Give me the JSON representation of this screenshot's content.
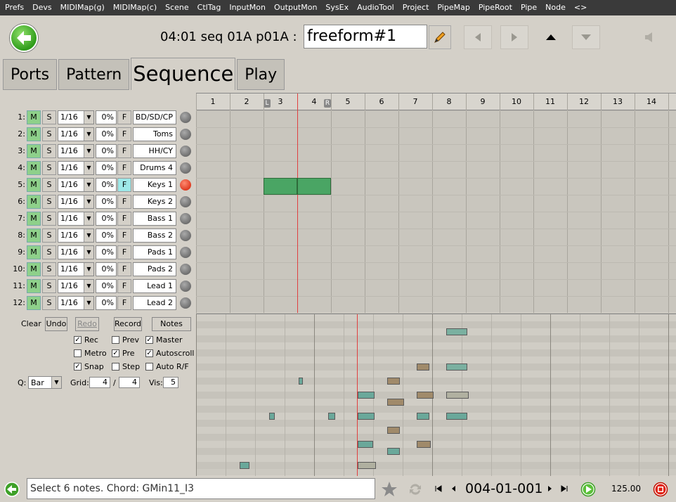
{
  "menu": [
    "Prefs",
    "Devs",
    "MIDIMap(g)",
    "MIDIMap(c)",
    "Scene",
    "CtlTag",
    "InputMon",
    "OutputMon",
    "SysEx",
    "AudioTool",
    "Project",
    "PipeMap",
    "PipeRoot",
    "Pipe",
    "Node",
    "<>"
  ],
  "header": {
    "seq_label": "04:01 seq  01A  p01A :",
    "seq_name": "freeform#1"
  },
  "tabs": [
    "Ports",
    "Pattern",
    "Sequence",
    "Play"
  ],
  "active_tab": "Sequence",
  "tracks": [
    {
      "num": "1:",
      "quant": "1/16",
      "pct": "0%",
      "name": "BD/SD/CP",
      "f_on": false,
      "active": false
    },
    {
      "num": "2:",
      "quant": "1/16",
      "pct": "0%",
      "name": "Toms",
      "f_on": false,
      "active": false
    },
    {
      "num": "3:",
      "quant": "1/16",
      "pct": "0%",
      "name": "HH/CY",
      "f_on": false,
      "active": false
    },
    {
      "num": "4:",
      "quant": "1/16",
      "pct": "0%",
      "name": "Drums 4",
      "f_on": false,
      "active": false
    },
    {
      "num": "5:",
      "quant": "1/16",
      "pct": "0%",
      "name": "Keys 1",
      "f_on": true,
      "active": true
    },
    {
      "num": "6:",
      "quant": "1/16",
      "pct": "0%",
      "name": "Keys 2",
      "f_on": false,
      "active": false
    },
    {
      "num": "7:",
      "quant": "1/16",
      "pct": "0%",
      "name": "Bass 1",
      "f_on": false,
      "active": false
    },
    {
      "num": "8:",
      "quant": "1/16",
      "pct": "0%",
      "name": "Bass 2",
      "f_on": false,
      "active": false
    },
    {
      "num": "9:",
      "quant": "1/16",
      "pct": "0%",
      "name": "Pads 1",
      "f_on": false,
      "active": false
    },
    {
      "num": "10:",
      "quant": "1/16",
      "pct": "0%",
      "name": "Pads 2",
      "f_on": false,
      "active": false
    },
    {
      "num": "11:",
      "quant": "1/16",
      "pct": "0%",
      "name": "Lead 1",
      "f_on": false,
      "active": false
    },
    {
      "num": "12:",
      "quant": "1/16",
      "pct": "0%",
      "name": "Lead 2",
      "f_on": false,
      "active": false
    }
  ],
  "track_button_labels": {
    "mute": "M",
    "solo": "S",
    "follow": "F"
  },
  "ruler": [
    "1",
    "2",
    "3",
    "4",
    "5",
    "6",
    "7",
    "8",
    "9",
    "10",
    "11",
    "12",
    "13",
    "14"
  ],
  "loop_markers": {
    "left": "L",
    "right": "R"
  },
  "controls": {
    "clear": "Clear",
    "undo": "Undo",
    "redo": "Redo",
    "record": "Record",
    "notes": "Notes",
    "checkboxes": [
      {
        "label": "Rec",
        "checked": true
      },
      {
        "label": "Prev",
        "checked": false
      },
      {
        "label": "Master",
        "checked": true
      },
      {
        "label": "Metro",
        "checked": false
      },
      {
        "label": "Pre",
        "checked": true
      },
      {
        "label": "Autoscroll",
        "checked": true
      },
      {
        "label": "Snap",
        "checked": true
      },
      {
        "label": "Step",
        "checked": false
      },
      {
        "label": "Auto R/F",
        "checked": false
      }
    ],
    "q_label": "Q:",
    "q_value": "Bar",
    "grid_label": "Grid:",
    "grid_num": "4",
    "grid_sep": "/",
    "grid_den": "4",
    "vis_label": "Vis:",
    "vis_value": "5"
  },
  "status": {
    "message": "Select 6 notes. Chord: GMin11_I3",
    "position": "004-01-001",
    "tempo": "125.00"
  },
  "colors": {
    "mute_green": "#8ed08a",
    "clip_green": "#4aa564",
    "note_teal": "#6aa89a",
    "record_red": "#e02010",
    "menubar": "#3a3a3a"
  }
}
